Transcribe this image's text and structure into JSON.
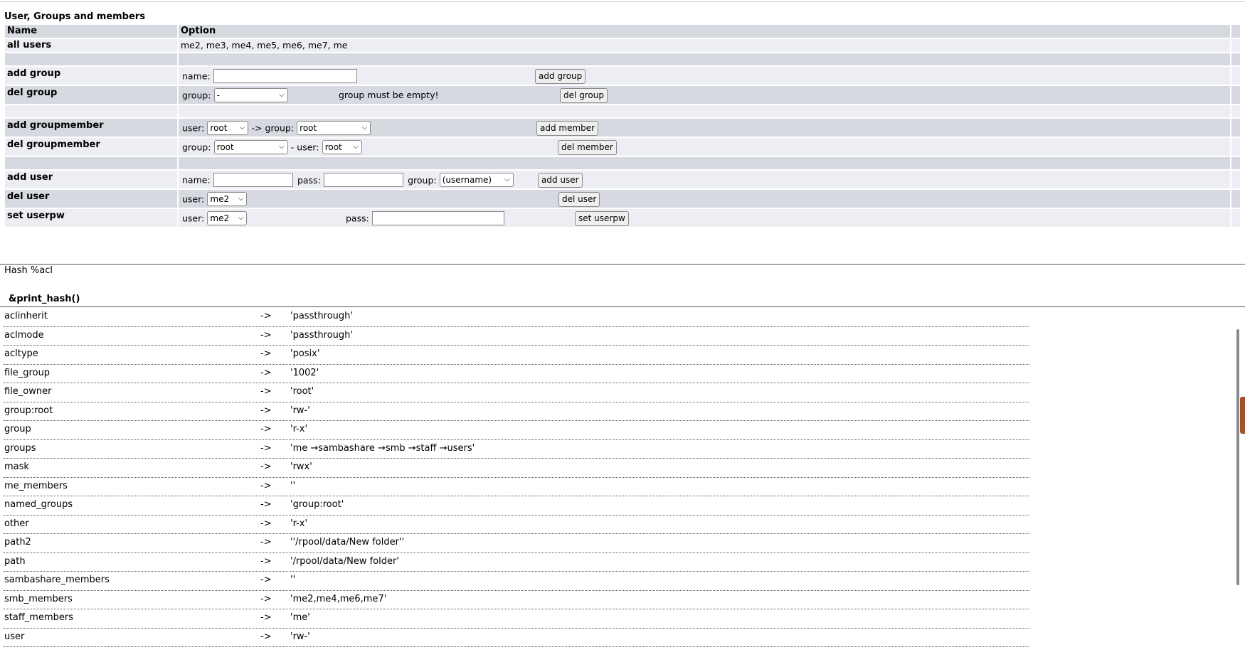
{
  "section_title": "User, Groups and members",
  "table": {
    "col_name": "Name",
    "col_option": "Option"
  },
  "all_users": {
    "label": "all users",
    "value": "me2, me3, me4, me5, me6, me7, me"
  },
  "add_group": {
    "label": "add group",
    "name_label": "name:",
    "name_value": "",
    "button": "add group"
  },
  "del_group": {
    "label": "del group",
    "group_label": "group:",
    "group_selected": "-",
    "note": "group must be empty!",
    "button": "del group"
  },
  "add_groupmember": {
    "label": "add groupmember",
    "user_label": "user:",
    "user_selected": "root",
    "arrow": "-> group:",
    "group_selected": "root",
    "button": "add member"
  },
  "del_groupmember": {
    "label": "del groupmember",
    "group_label": "group:",
    "group_selected": "root",
    "sep": "- user:",
    "user_selected": "root",
    "button": "del member"
  },
  "add_user": {
    "label": "add user",
    "name_label": "name:",
    "name_value": "",
    "pass_label": "pass:",
    "pass_value": "",
    "group_label": "group:",
    "group_selected": "(username)",
    "button": "add user"
  },
  "del_user": {
    "label": "del user",
    "user_label": "user:",
    "user_selected": "me2",
    "button": "del user"
  },
  "set_userpw": {
    "label": "set userpw",
    "user_label": "user:",
    "user_selected": "me2",
    "pass_label": "pass:",
    "pass_value": "",
    "button": "set userpw"
  },
  "hash_title": "Hash %acl",
  "print_hash_title": "&print_hash()",
  "hash_arrow": "->",
  "hash": [
    {
      "key": "aclinherit",
      "value": "'passthrough'"
    },
    {
      "key": "aclmode",
      "value": "'passthrough'"
    },
    {
      "key": "acltype",
      "value": "'posix'"
    },
    {
      "key": "file_group",
      "value": "'1002'"
    },
    {
      "key": "file_owner",
      "value": "'root'"
    },
    {
      "key": "group:root",
      "value": "'rw-'"
    },
    {
      "key": "group",
      "value": "'r-x'"
    },
    {
      "key": "groups",
      "value": "'me →sambashare →smb →staff →users'"
    },
    {
      "key": "mask",
      "value": "'rwx'"
    },
    {
      "key": "me_members",
      "value": "''"
    },
    {
      "key": "named_groups",
      "value": "'group:root'"
    },
    {
      "key": "other",
      "value": "'r-x'"
    },
    {
      "key": "path2",
      "value": "''/rpool/data/New folder''"
    },
    {
      "key": "path",
      "value": "'/rpool/data/New folder'"
    },
    {
      "key": "sambashare_members",
      "value": "''"
    },
    {
      "key": "smb_members",
      "value": "'me2,me4,me6,me7'"
    },
    {
      "key": "staff_members",
      "value": "'me'"
    },
    {
      "key": "user",
      "value": "'rw-'"
    }
  ]
}
